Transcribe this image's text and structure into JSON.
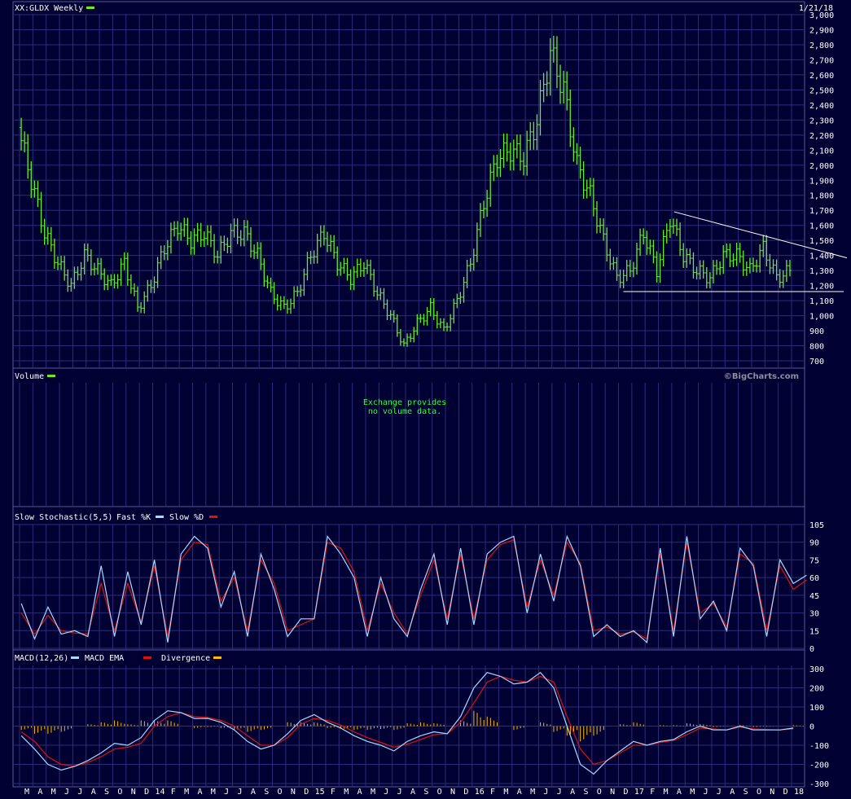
{
  "header": {
    "symbol_title": "XX:GLDX Weekly",
    "date": "1/21/18",
    "watermark": "©BigCharts.com"
  },
  "colors": {
    "background": "#000033",
    "grid": "#2e2e7a",
    "price_bars": "#66ee22",
    "stoch_fast": "#a8d8ff",
    "stoch_slow": "#dd1111",
    "macd": "#a8d8ff",
    "macd_ema": "#dd1111",
    "divergence": "#ffbb00",
    "trendline": "#ffffff"
  },
  "volume_panel": {
    "title": "Volume",
    "message_line1": "Exchange provides",
    "message_line2": "no volume data."
  },
  "x_axis": {
    "labels": [
      "M",
      "A",
      "M",
      "J",
      "J",
      "A",
      "S",
      "O",
      "N",
      "D",
      "14",
      "F",
      "M",
      "A",
      "M",
      "J",
      "J",
      "A",
      "S",
      "O",
      "N",
      "D",
      "15",
      "F",
      "M",
      "A",
      "M",
      "J",
      "J",
      "A",
      "S",
      "O",
      "N",
      "D",
      "16",
      "F",
      "M",
      "A",
      "M",
      "J",
      "J",
      "A",
      "S",
      "O",
      "N",
      "D",
      "17",
      "F",
      "M",
      "A",
      "M",
      "J",
      "J",
      "A",
      "S",
      "O",
      "N",
      "D",
      "18"
    ]
  },
  "chart_data": [
    {
      "type": "ohlc",
      "title": "XX:GLDX Weekly",
      "ylim": [
        700,
        3000
      ],
      "yticks": [
        "3,000",
        "2,900",
        "2,800",
        "2,700",
        "2,600",
        "2,500",
        "2,400",
        "2,300",
        "2,200",
        "2,100",
        "2,000",
        "1,900",
        "1,800",
        "1,700",
        "1,600",
        "1,500",
        "1,400",
        "1,300",
        "1,200",
        "1,100",
        "1,000",
        "900",
        "800",
        "700"
      ],
      "x_months": [
        "M",
        "A",
        "M",
        "J",
        "J",
        "A",
        "S",
        "O",
        "N",
        "D",
        "14",
        "F",
        "M",
        "A",
        "M",
        "J",
        "J",
        "A",
        "S",
        "O",
        "N",
        "D",
        "15",
        "F",
        "M",
        "A",
        "M",
        "J",
        "J",
        "A",
        "S",
        "O",
        "N",
        "D",
        "16",
        "F",
        "M",
        "A",
        "M",
        "J",
        "J",
        "A",
        "S",
        "O",
        "N",
        "D",
        "17",
        "F",
        "M",
        "A",
        "M",
        "J",
        "J",
        "A",
        "S",
        "O",
        "N",
        "D",
        "18"
      ],
      "monthly_close": [
        2250,
        1900,
        1550,
        1350,
        1200,
        1400,
        1300,
        1200,
        1350,
        1050,
        1200,
        1450,
        1600,
        1500,
        1550,
        1400,
        1550,
        1550,
        1400,
        1150,
        1050,
        1150,
        1400,
        1550,
        1350,
        1250,
        1350,
        1150,
        1000,
        800,
        950,
        1050,
        900,
        1100,
        1350,
        1750,
        2050,
        2100,
        2050,
        2300,
        2750,
        2500,
        2000,
        1800,
        1500,
        1250,
        1300,
        1550,
        1300,
        1650,
        1400,
        1300,
        1250,
        1400,
        1400,
        1300,
        1450,
        1250,
        1300
      ],
      "trendline_upper": {
        "from": {
          "x": "A 17",
          "y": 1690
        },
        "to": {
          "x": "18",
          "y": 1330
        }
      },
      "support_line": 1160
    },
    {
      "type": "line",
      "title": "Slow Stochastic(5,5)",
      "series": [
        {
          "name": "Fast %K",
          "values": [
            38,
            8,
            35,
            12,
            15,
            10,
            70,
            10,
            65,
            20,
            75,
            5,
            80,
            95,
            85,
            35,
            65,
            10,
            80,
            50,
            10,
            25,
            25,
            95,
            80,
            60,
            10,
            60,
            25,
            10,
            50,
            80,
            20,
            85,
            20,
            80,
            90,
            95,
            30,
            80,
            40,
            95,
            70,
            10,
            20,
            10,
            15,
            5,
            85,
            10,
            95,
            25,
            40,
            15,
            85,
            70,
            10,
            75,
            55,
            62
          ]
        },
        {
          "name": "Slow %D",
          "values": [
            30,
            12,
            28,
            15,
            13,
            12,
            55,
            15,
            55,
            22,
            70,
            10,
            75,
            90,
            88,
            40,
            60,
            15,
            75,
            55,
            15,
            20,
            25,
            90,
            85,
            65,
            15,
            55,
            30,
            12,
            45,
            75,
            25,
            80,
            25,
            75,
            88,
            92,
            35,
            75,
            45,
            90,
            72,
            15,
            18,
            12,
            14,
            8,
            80,
            15,
            90,
            30,
            38,
            18,
            80,
            72,
            15,
            70,
            50,
            58
          ]
        }
      ],
      "ylim": [
        0,
        105
      ],
      "yticks": [
        "105",
        "90",
        "75",
        "60",
        "45",
        "30",
        "15",
        "0"
      ]
    },
    {
      "type": "line",
      "title": "MACD(12,26)",
      "series": [
        {
          "name": "MACD",
          "values": [
            -50,
            -120,
            -200,
            -230,
            -210,
            -180,
            -140,
            -90,
            -100,
            -60,
            30,
            80,
            70,
            40,
            40,
            20,
            -20,
            -80,
            -120,
            -100,
            -40,
            30,
            60,
            20,
            -10,
            -50,
            -80,
            -100,
            -130,
            -80,
            -50,
            -30,
            -40,
            50,
            200,
            280,
            260,
            220,
            230,
            280,
            200,
            0,
            -200,
            -250,
            -180,
            -130,
            -80,
            -100,
            -80,
            -70,
            -30,
            0,
            -20,
            -20,
            0,
            -20,
            -20,
            -20,
            -10
          ]
        },
        {
          "name": "MACD EMA",
          "values": [
            -30,
            -80,
            -160,
            -200,
            -210,
            -190,
            -160,
            -120,
            -110,
            -90,
            0,
            50,
            70,
            50,
            45,
            30,
            0,
            -50,
            -100,
            -100,
            -60,
            10,
            40,
            30,
            5,
            -30,
            -60,
            -85,
            -110,
            -95,
            -70,
            -45,
            -40,
            20,
            120,
            230,
            260,
            240,
            230,
            260,
            230,
            50,
            -120,
            -200,
            -180,
            -140,
            -100,
            -100,
            -85,
            -75,
            -45,
            -10,
            -15,
            -20,
            -5,
            -15,
            -18,
            -20,
            -15
          ]
        },
        {
          "name": "Divergence",
          "values": [
            -20,
            -40,
            -40,
            -30,
            0,
            10,
            20,
            30,
            10,
            30,
            30,
            30,
            0,
            -10,
            -5,
            -10,
            -20,
            -30,
            -20,
            0,
            20,
            20,
            20,
            -10,
            -15,
            -20,
            -20,
            -15,
            -20,
            15,
            20,
            15,
            0,
            30,
            80,
            50,
            0,
            -20,
            0,
            20,
            -30,
            -50,
            -80,
            -50,
            0,
            10,
            20,
            0,
            5,
            5,
            15,
            10,
            -5,
            0,
            5,
            -5,
            -2,
            0,
            5
          ]
        }
      ],
      "ylim": [
        -300,
        300
      ],
      "yticks": [
        "300",
        "200",
        "100",
        "0",
        "-100",
        "-200",
        "-300"
      ]
    }
  ]
}
